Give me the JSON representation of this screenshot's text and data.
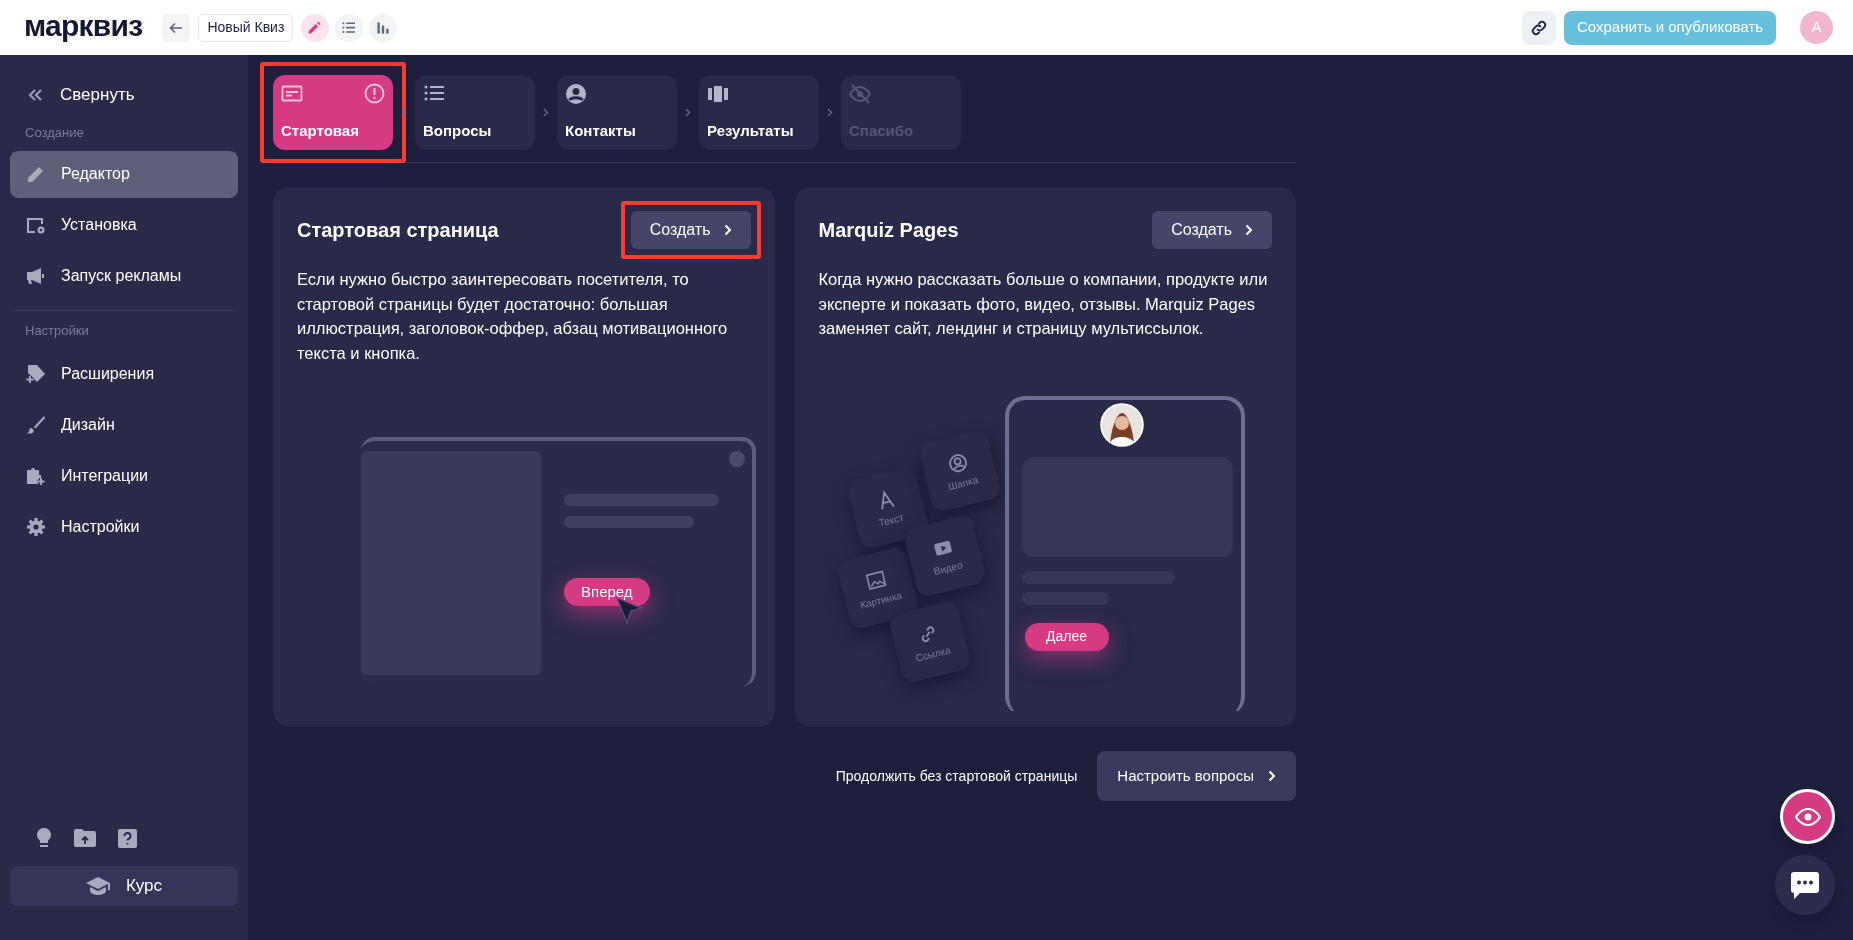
{
  "header": {
    "logo": "марквиз",
    "quiz_name": "Новый Квиз",
    "modes": [
      {
        "selected": true
      },
      {
        "selected": false
      },
      {
        "selected": false
      }
    ],
    "publish_button": "Сохранить и опубликовать",
    "avatar": "А"
  },
  "sidebar": {
    "collapse": "Свернуть",
    "sections": [
      {
        "title": "Создание",
        "items": [
          {
            "label": "Редактор",
            "selected": true
          },
          {
            "label": "Установка",
            "selected": false
          },
          {
            "label": "Запуск рекламы",
            "selected": false
          }
        ]
      },
      {
        "title": "Настройки",
        "items": [
          {
            "label": "Расширения",
            "selected": false
          },
          {
            "label": "Дизайн",
            "selected": false
          },
          {
            "label": "Интеграции",
            "selected": false
          },
          {
            "label": "Настройки",
            "selected": false
          }
        ]
      }
    ],
    "course_button": "Курс"
  },
  "steps": [
    {
      "label": "Стартовая",
      "selected": true,
      "warning": true,
      "disabled": false,
      "highlighted": true
    },
    {
      "label": "Вопросы",
      "selected": false,
      "warning": false,
      "disabled": false,
      "highlighted": false
    },
    {
      "label": "Контакты",
      "selected": false,
      "warning": false,
      "disabled": false,
      "highlighted": false
    },
    {
      "label": "Результаты",
      "selected": false,
      "warning": false,
      "disabled": false,
      "highlighted": false
    },
    {
      "label": "Спасибо",
      "selected": false,
      "warning": false,
      "disabled": true,
      "highlighted": false
    }
  ],
  "cards": [
    {
      "kind": "start",
      "title": "Стартовая страница",
      "button": "Создать",
      "button_highlighted": true,
      "text": "Если нужно быстро заинтересовать посетителя, то стартовой страницы будет достаточно: большая иллюстрация, заголовок-оффер, абзац мотивационного текста и кнопка.",
      "illustration_button": "Вперед"
    },
    {
      "kind": "pages",
      "title": "Marquiz Pages",
      "button": "Создать",
      "button_highlighted": false,
      "text": "Когда нужно рассказать больше о компании, продукте или эксперте и показать фото, видео, отзывы. Marquiz Pages заменяет сайт, лендинг и страницу мультиссылок.",
      "tiles": [
        "Текст",
        "Шапка",
        "Картинка",
        "Видео",
        "Ссылка"
      ],
      "illustration_button": "Далее"
    }
  ],
  "footer": {
    "skip_text": "Продолжить без стартовой страницы",
    "next_button": "Настроить вопросы"
  }
}
